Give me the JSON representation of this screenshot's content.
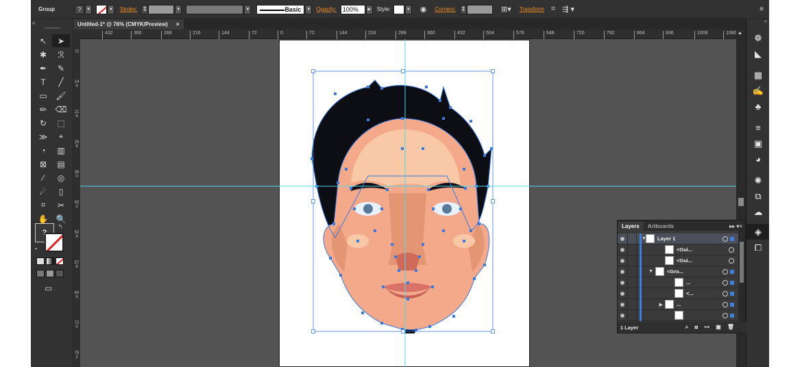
{
  "control_bar": {
    "selection_type": "Group",
    "fill_value": "?",
    "stroke_label": "Stroke:",
    "brush_label": "Basic",
    "opacity_label": "Opacity:",
    "opacity_value": "100%",
    "style_label": "Style:",
    "corners_label": "Corners:",
    "transform_label": "Transform"
  },
  "document_tab": {
    "title": "Untitled-1* @ 76% (CMYK/Preview)",
    "close_glyph": "×"
  },
  "rulers": {
    "horizontal": [
      "432",
      "360",
      "288",
      "216",
      "144",
      "72",
      "0",
      "72",
      "144",
      "216",
      "288",
      "360",
      "432",
      "504",
      "576",
      "648",
      "720",
      "792",
      "864",
      "936",
      "1008",
      "1080"
    ],
    "vertical": [
      "72",
      "144",
      "216",
      "288",
      "360",
      "432",
      "504",
      "576",
      "648",
      "720",
      "792"
    ]
  },
  "tools": {
    "fill_question": "?",
    "icons": [
      "selection-icon",
      "direct-selection-icon",
      "magic-wand-icon",
      "lasso-icon",
      "pen-icon",
      "curvature-icon",
      "type-icon",
      "line-icon",
      "rectangle-icon",
      "paintbrush-icon",
      "pencil-icon",
      "eraser-icon",
      "rotate-icon",
      "scale-icon",
      "width-icon",
      "free-transform-icon",
      "shape-builder-icon",
      "perspective-icon",
      "mesh-icon",
      "gradient-icon",
      "eyedropper-icon",
      "blend-icon",
      "symbol-sprayer-icon",
      "column-graph-icon",
      "artboard-icon",
      "slice-icon",
      "hand-icon",
      "zoom-icon"
    ]
  },
  "layers_panel": {
    "tabs": [
      "Layers",
      "Artboards"
    ],
    "rows": [
      {
        "name": "Layer 1",
        "indent": 0,
        "expanded": true
      },
      {
        "name": "<Gui...",
        "indent": 2
      },
      {
        "name": "<Gui...",
        "indent": 2
      },
      {
        "name": "<Gro...",
        "indent": 1,
        "expanded": true
      },
      {
        "name": "...",
        "indent": 3
      },
      {
        "name": "<...",
        "indent": 3
      },
      {
        "name": "...",
        "indent": 2,
        "collapsed": true
      },
      {
        "name": "",
        "indent": 3
      }
    ],
    "footer": "1 Layer"
  },
  "colors": {
    "skin": "#f4a98a",
    "skin_light": "#f9c8a6",
    "skin_shadow": "#e49674",
    "hair": "#0d0d14",
    "lips": "#d9736a",
    "anchor": "#3a7ae0",
    "guide": "#4ed9f0",
    "accent": "#f08c24"
  }
}
